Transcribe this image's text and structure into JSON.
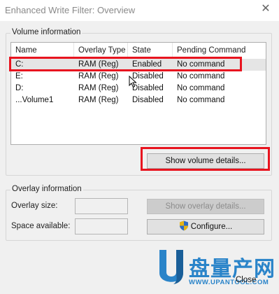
{
  "window": {
    "title": "Enhanced Write Filter: Overview",
    "close_glyph": "✕"
  },
  "volume_info": {
    "group_label": "Volume information",
    "columns": [
      "Name",
      "Overlay Type",
      "State",
      "Pending Command"
    ],
    "rows": [
      {
        "name": "C:",
        "overlay_type": "RAM (Reg)",
        "state": "Enabled",
        "pending": "No command"
      },
      {
        "name": "E:",
        "overlay_type": "RAM (Reg)",
        "state": "Disabled",
        "pending": "No command"
      },
      {
        "name": "D:",
        "overlay_type": "RAM (Reg)",
        "state": "Disabled",
        "pending": "No command"
      },
      {
        "name": "...Volume1",
        "overlay_type": "RAM (Reg)",
        "state": "Disabled",
        "pending": "No command"
      }
    ],
    "show_details_button": "Show volume details..."
  },
  "overlay_info": {
    "group_label": "Overlay information",
    "overlay_size_label": "Overlay size:",
    "space_available_label": "Space available:",
    "overlay_size_value": "",
    "space_available_value": "",
    "show_overlay_button": "Show overlay details...",
    "configure_button": "Configure..."
  },
  "footer": {
    "close_button": "Close"
  },
  "watermark": {
    "logo_letter": "U",
    "chinese_text": "盘量产网",
    "url": "WWW.UPANTOOL.COM"
  },
  "colors": {
    "highlight": "#e8141f",
    "watermark": "#2a84c9"
  }
}
